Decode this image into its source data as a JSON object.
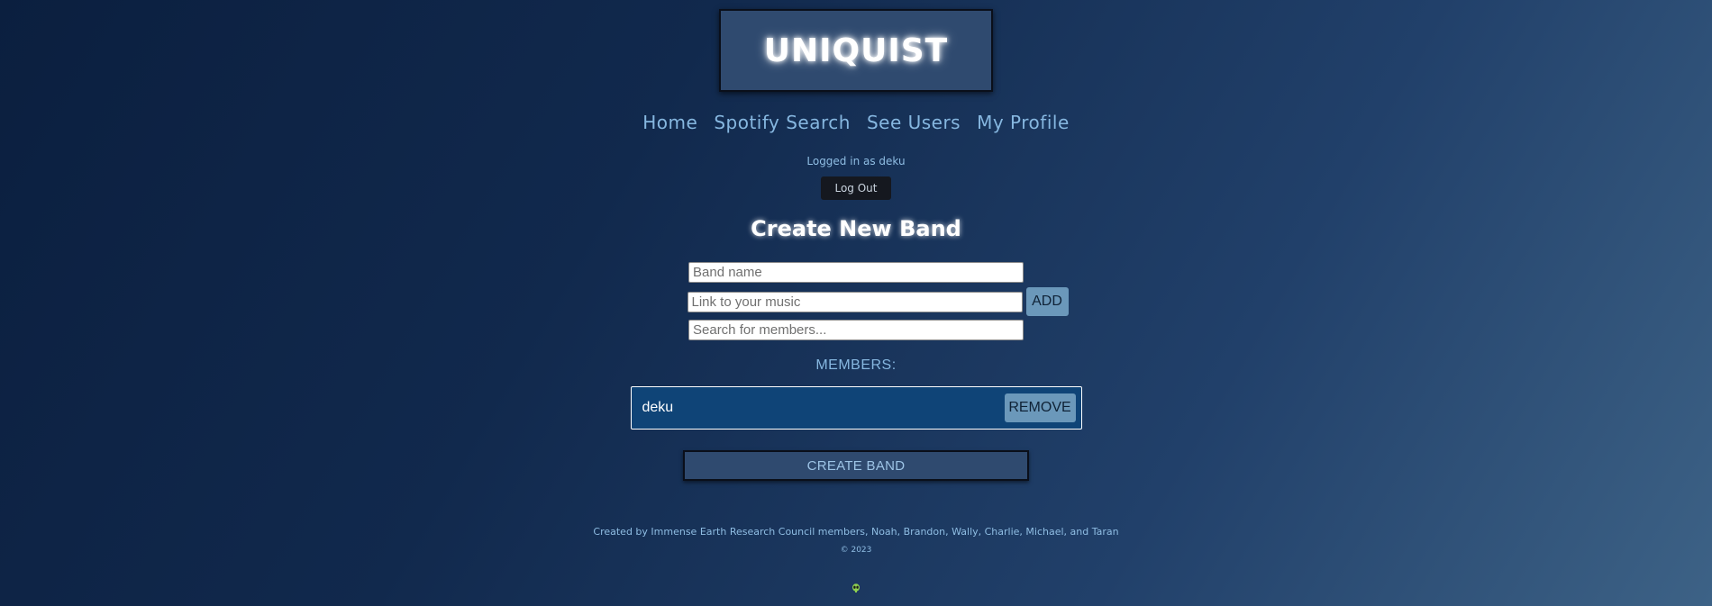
{
  "header": {
    "logo_text": "UNIQUIST"
  },
  "nav": {
    "items": [
      {
        "label": "Home"
      },
      {
        "label": "Spotify Search"
      },
      {
        "label": "See Users"
      },
      {
        "label": "My Profile"
      }
    ]
  },
  "session": {
    "logged_in_text": "Logged in as deku",
    "logout_label": "Log Out"
  },
  "form": {
    "title": "Create New Band",
    "band_name_placeholder": "Band name",
    "music_link_placeholder": "Link to your music",
    "add_label": "ADD",
    "member_search_placeholder": "Search for members...",
    "members_label": "MEMBERS:",
    "members": [
      {
        "name": "deku",
        "remove_label": "REMOVE"
      }
    ],
    "create_label": "CREATE BAND"
  },
  "footer": {
    "credits": "Created by Immense Earth Research Council members, Noah, Brandon, Wally, Charlie, Michael, and Taran",
    "copyright": "© 2023",
    "alien_icon": "alien-icon"
  },
  "colors": {
    "accent": "#86b7e0",
    "button": "#6b98ba",
    "member_bg": "#0f4477"
  }
}
